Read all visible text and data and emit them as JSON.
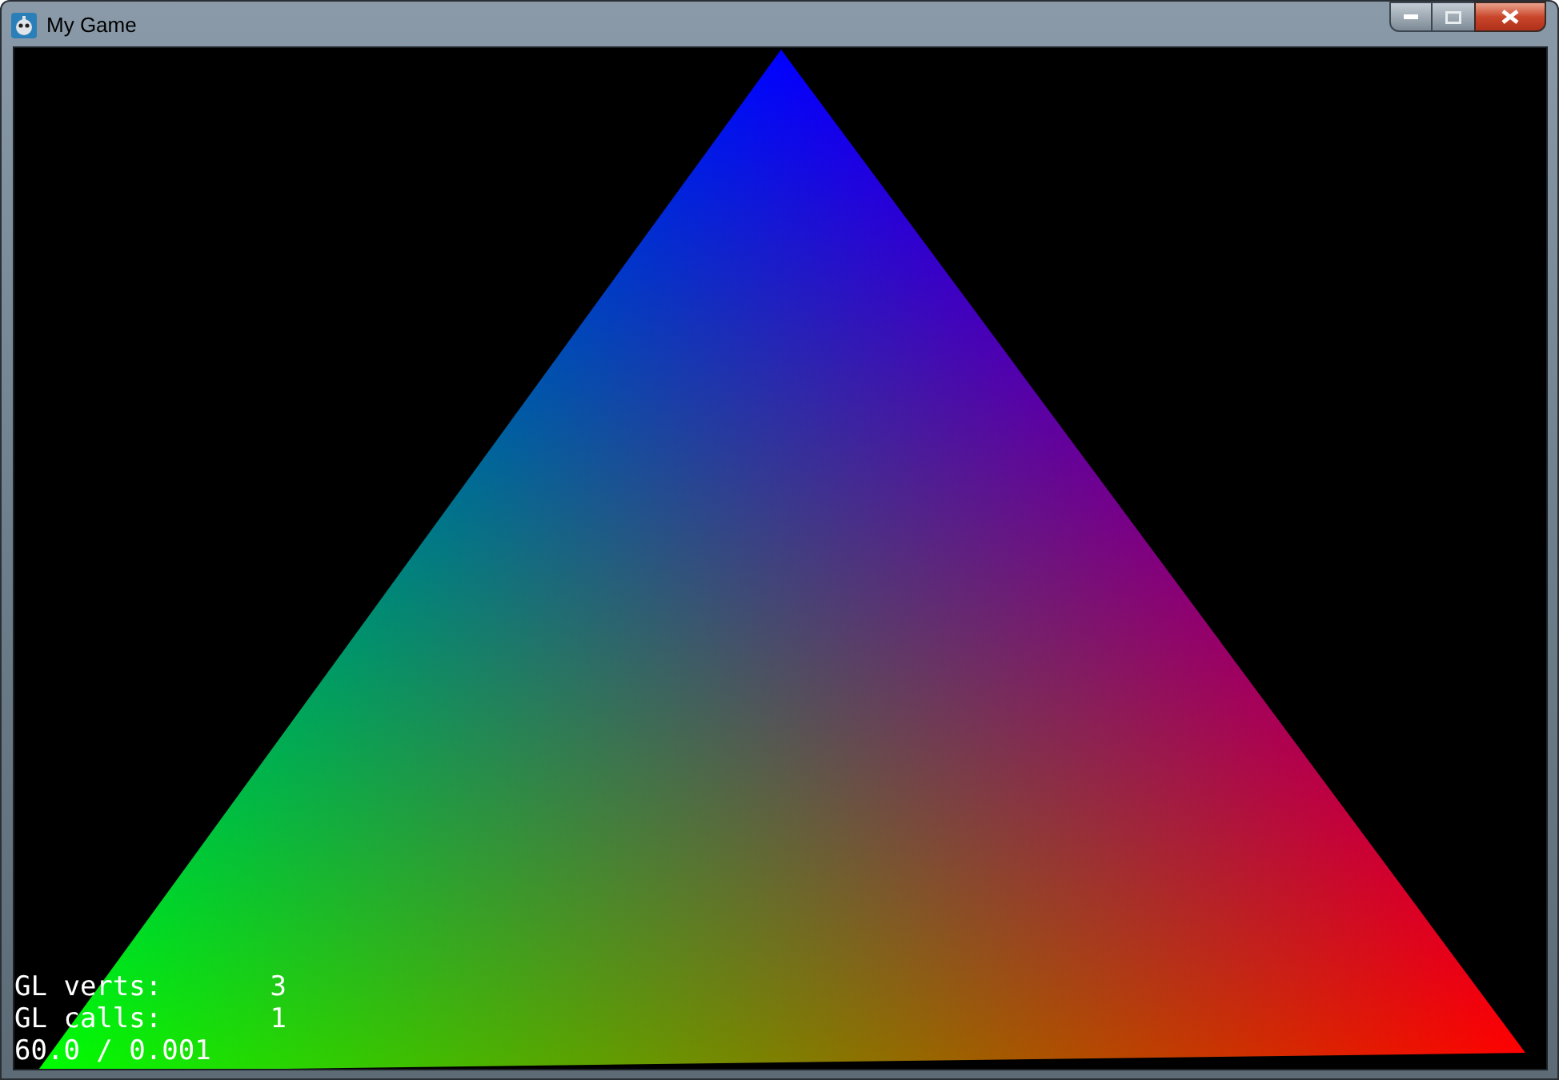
{
  "window": {
    "title": "My Game"
  },
  "stats": [
    {
      "label": "GL verts:",
      "value": "3"
    },
    {
      "label": "GL calls:",
      "value": "1"
    }
  ],
  "fps": "60.0 / 0.001"
}
